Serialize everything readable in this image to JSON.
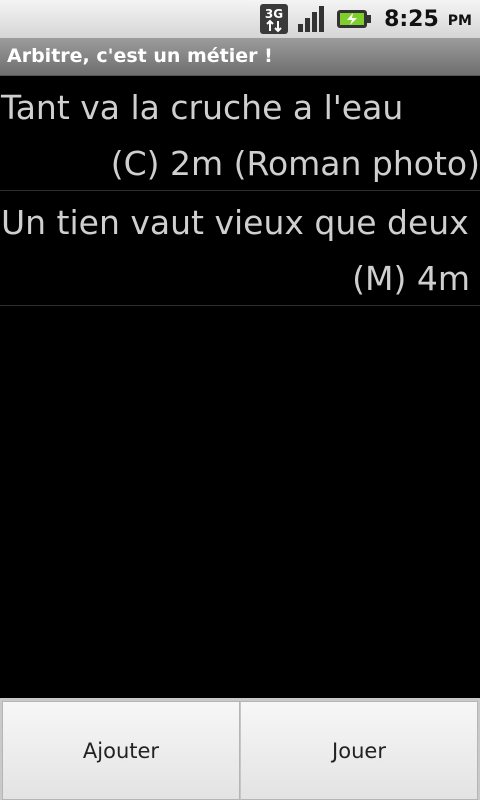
{
  "status_bar": {
    "network_label": "3G",
    "time": "8:25",
    "ampm": "PM"
  },
  "app": {
    "title": "Arbitre, c'est un métier !"
  },
  "list": {
    "items": [
      {
        "title": "Tant va la cruche a l'eau",
        "meta": "(C) 2m  (Roman photo)"
      },
      {
        "title": "Un tien vaut vieux que deux",
        "meta": "(M) 4m"
      }
    ]
  },
  "buttons": {
    "add_label": "Ajouter",
    "play_label": "Jouer"
  }
}
